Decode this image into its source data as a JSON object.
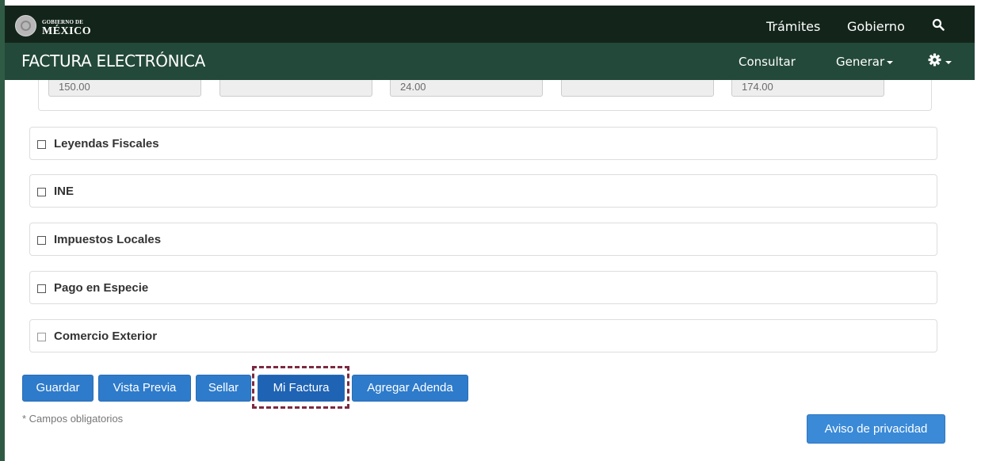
{
  "header": {
    "logo_small": "GOBIERNO DE",
    "logo_big": "MÉXICO",
    "links": [
      "Trámites",
      "Gobierno"
    ],
    "search_icon": "search-icon"
  },
  "subheader": {
    "title": "FACTURA ELECTRÓNICA",
    "consultar": "Consultar",
    "generar": "Generar",
    "settings_icon": "gear-icon"
  },
  "totals": {
    "values": [
      "150.00",
      "",
      "24.00",
      "",
      "174.00"
    ]
  },
  "sections": [
    {
      "label": "Leyendas Fiscales",
      "checked": false
    },
    {
      "label": "INE",
      "checked": false
    },
    {
      "label": "Impuestos Locales",
      "checked": false
    },
    {
      "label": "Pago en Especie",
      "checked": false
    },
    {
      "label": "Comercio Exterior",
      "checked": false
    }
  ],
  "actions": {
    "guardar": "Guardar",
    "vista_previa": "Vista Previa",
    "sellar": "Sellar",
    "mi_factura": "Mi Factura",
    "agregar_adenda": "Agregar Adenda"
  },
  "footer": {
    "required_note": "* Campos obligatorios",
    "privacy": "Aviso de privacidad"
  },
  "colors": {
    "topbar": "#13251b",
    "subbar": "#23493a",
    "button": "#2e7bcb",
    "highlight": "#7c2a41"
  }
}
